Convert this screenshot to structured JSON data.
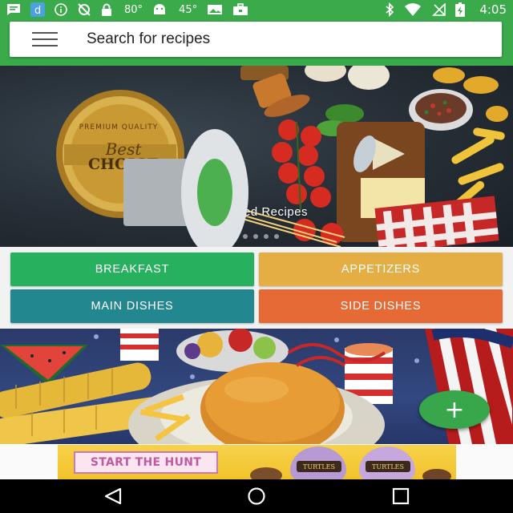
{
  "status_bar": {
    "time": "4:05",
    "temp_1": "80°",
    "temp_2": "45°",
    "icons": [
      "message-icon",
      "d-app-icon",
      "info-icon",
      "no-sync-icon",
      "lock-icon",
      "android-icon",
      "photo-icon",
      "briefcase-icon",
      "bluetooth-icon",
      "wifi-icon",
      "no-signal-icon",
      "battery-charging-icon"
    ]
  },
  "search": {
    "placeholder": "Search for recipes",
    "menu_icon": "hamburger-menu-icon"
  },
  "hero": {
    "caption": "ked Recipes",
    "badge_line_1": "PREMIUM QUALITY",
    "badge_line_2": "Best",
    "badge_line_3": "CHOICE",
    "slide_count": 5,
    "active_slide": 0
  },
  "overlay": {
    "icon": "speaker-icon",
    "accent": "#4caf50"
  },
  "categories": [
    {
      "label": "BREAKFAST",
      "color": "#27b15f"
    },
    {
      "label": "APPETIZERS",
      "color": "#e4ae44"
    },
    {
      "label": "MAIN DISHES",
      "color": "#22878e"
    },
    {
      "label": "SIDE DISHES",
      "color": "#e56a35"
    }
  ],
  "fab": {
    "label": "+",
    "icon": "add-icon",
    "color": "#38a64a"
  },
  "ad": {
    "cta": "START THE HUNT",
    "egg_label_1": "TURTLES",
    "egg_label_2": "TURTLES"
  },
  "nav": {
    "back": "back-triangle-icon",
    "home": "home-circle-icon",
    "recents": "recents-square-icon"
  }
}
